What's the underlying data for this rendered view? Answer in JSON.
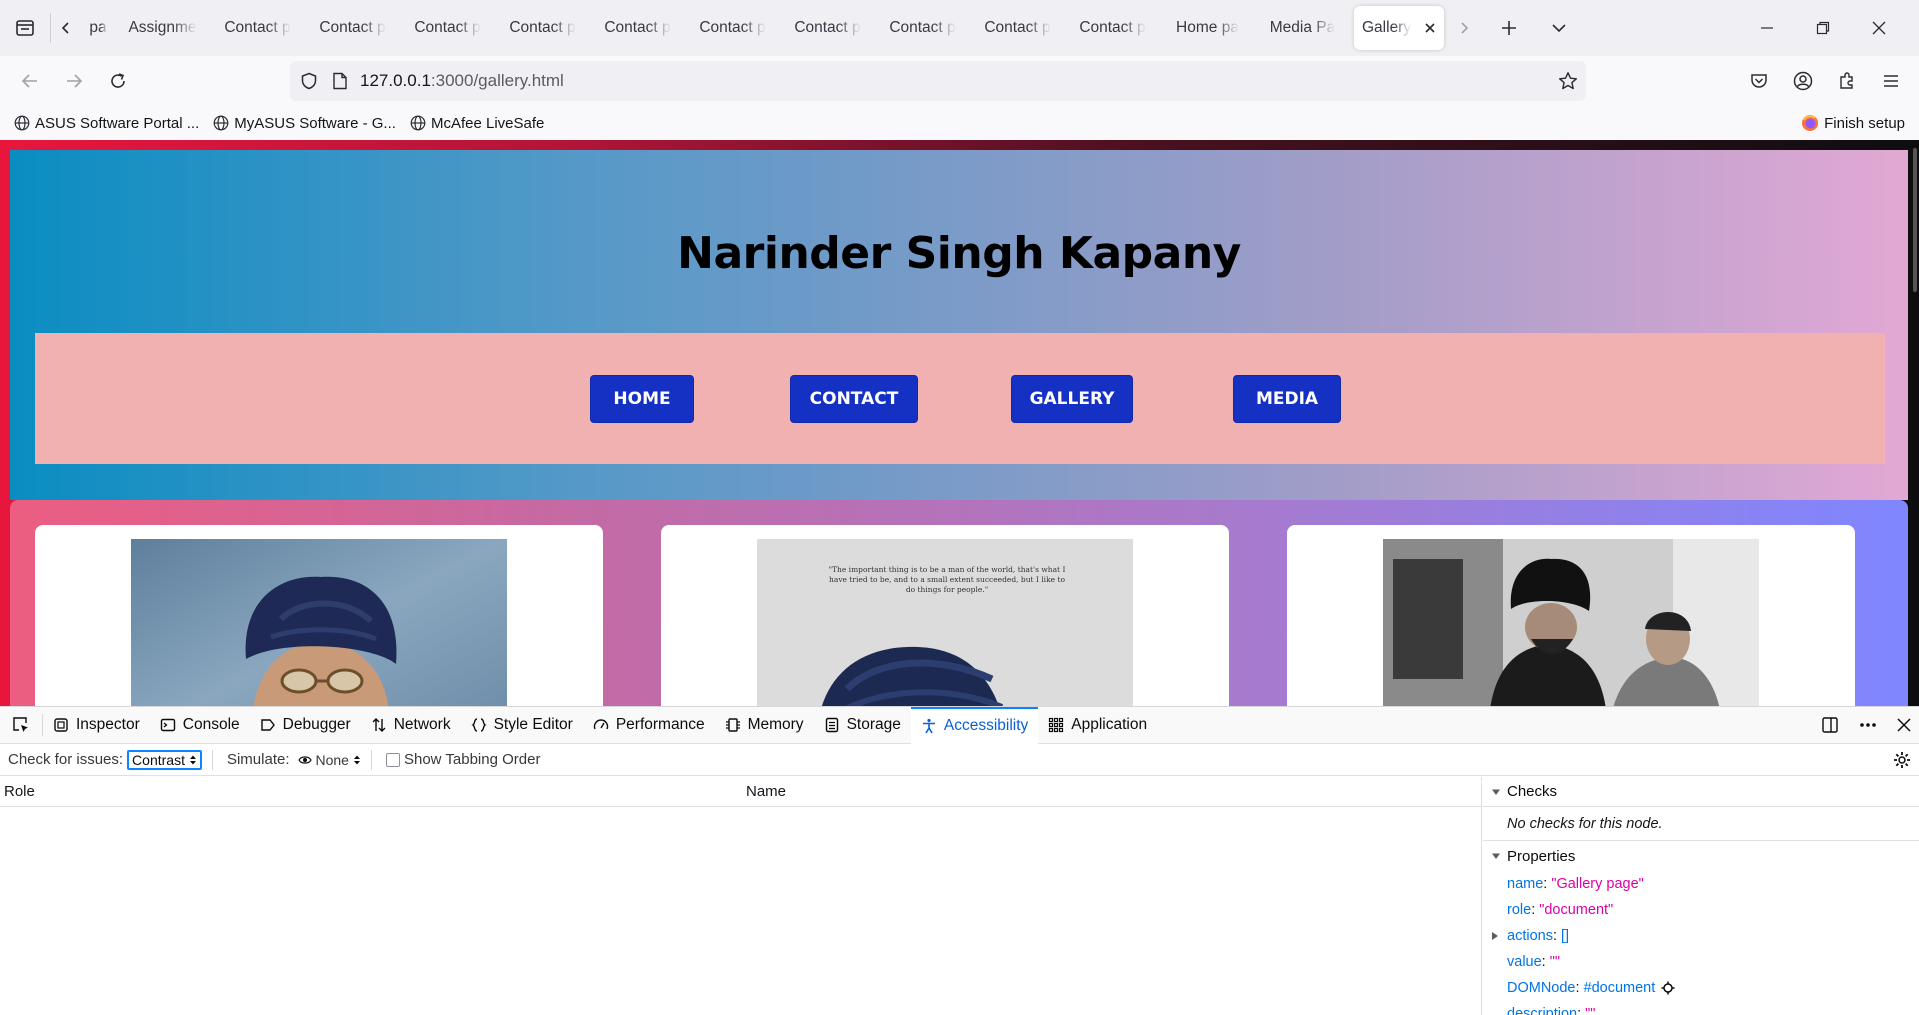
{
  "browser": {
    "tabs": [
      {
        "label": "pa",
        "active": false
      },
      {
        "label": "Assignme",
        "active": false
      },
      {
        "label": "Contact p",
        "active": false
      },
      {
        "label": "Contact p",
        "active": false
      },
      {
        "label": "Contact p",
        "active": false
      },
      {
        "label": "Contact p",
        "active": false
      },
      {
        "label": "Contact p",
        "active": false
      },
      {
        "label": "Contact p",
        "active": false
      },
      {
        "label": "Contact p",
        "active": false
      },
      {
        "label": "Contact p",
        "active": false
      },
      {
        "label": "Contact p",
        "active": false
      },
      {
        "label": "Contact p",
        "active": false
      },
      {
        "label": "Home pa",
        "active": false
      },
      {
        "label": "Media Pa",
        "active": false
      },
      {
        "label": "Gallery",
        "active": true
      }
    ],
    "url_host": "127.0.0.1",
    "url_path": ":3000/gallery.html",
    "bookmarks": [
      {
        "label": "ASUS Software Portal ..."
      },
      {
        "label": "MyASUS Software - G..."
      },
      {
        "label": "McAfee LiveSafe"
      }
    ],
    "finish_setup": "Finish setup"
  },
  "page": {
    "title": "Narinder Singh Kapany",
    "nav": {
      "home": "HOME",
      "contact": "CONTACT",
      "gallery": "GALLERY",
      "media": "MEDIA"
    },
    "quote": "\"The important thing is to be a man of the world, that's what I have tried to be, and to a small extent succeeded, but I like to do things for people.\""
  },
  "devtools": {
    "tabs": [
      {
        "label": "Inspector",
        "icon": "inspector-icon"
      },
      {
        "label": "Console",
        "icon": "console-icon"
      },
      {
        "label": "Debugger",
        "icon": "debugger-icon"
      },
      {
        "label": "Network",
        "icon": "network-icon"
      },
      {
        "label": "Style Editor",
        "icon": "style-editor-icon"
      },
      {
        "label": "Performance",
        "icon": "performance-icon"
      },
      {
        "label": "Memory",
        "icon": "memory-icon"
      },
      {
        "label": "Storage",
        "icon": "storage-icon"
      },
      {
        "label": "Accessibility",
        "icon": "accessibility-icon",
        "active": true
      },
      {
        "label": "Application",
        "icon": "application-icon"
      }
    ],
    "check_for_issues_label": "Check for issues:",
    "check_for_issues_value": "Contrast",
    "simulate_label": "Simulate:",
    "simulate_value": "None",
    "show_tabbing_order": "Show Tabbing Order",
    "columns": {
      "role": "Role",
      "name": "Name"
    },
    "checks": {
      "heading": "Checks",
      "empty": "No checks for this node."
    },
    "properties": {
      "heading": "Properties",
      "items": [
        {
          "key": "name",
          "value": "\"Gallery page\""
        },
        {
          "key": "role",
          "value": "\"document\""
        },
        {
          "key": "actions",
          "value": "[]"
        },
        {
          "key": "value",
          "value": "\"\""
        },
        {
          "key": "DOMNode",
          "value": "#document"
        },
        {
          "key": "description",
          "value": "\"\""
        }
      ]
    }
  },
  "colors": {
    "nav_button": "#1431c4",
    "header_start": "#0a8dc2",
    "header_end": "#e2a8d4",
    "nav_band": "#f0b1b0",
    "devtools_accent": "#0a84ff"
  }
}
